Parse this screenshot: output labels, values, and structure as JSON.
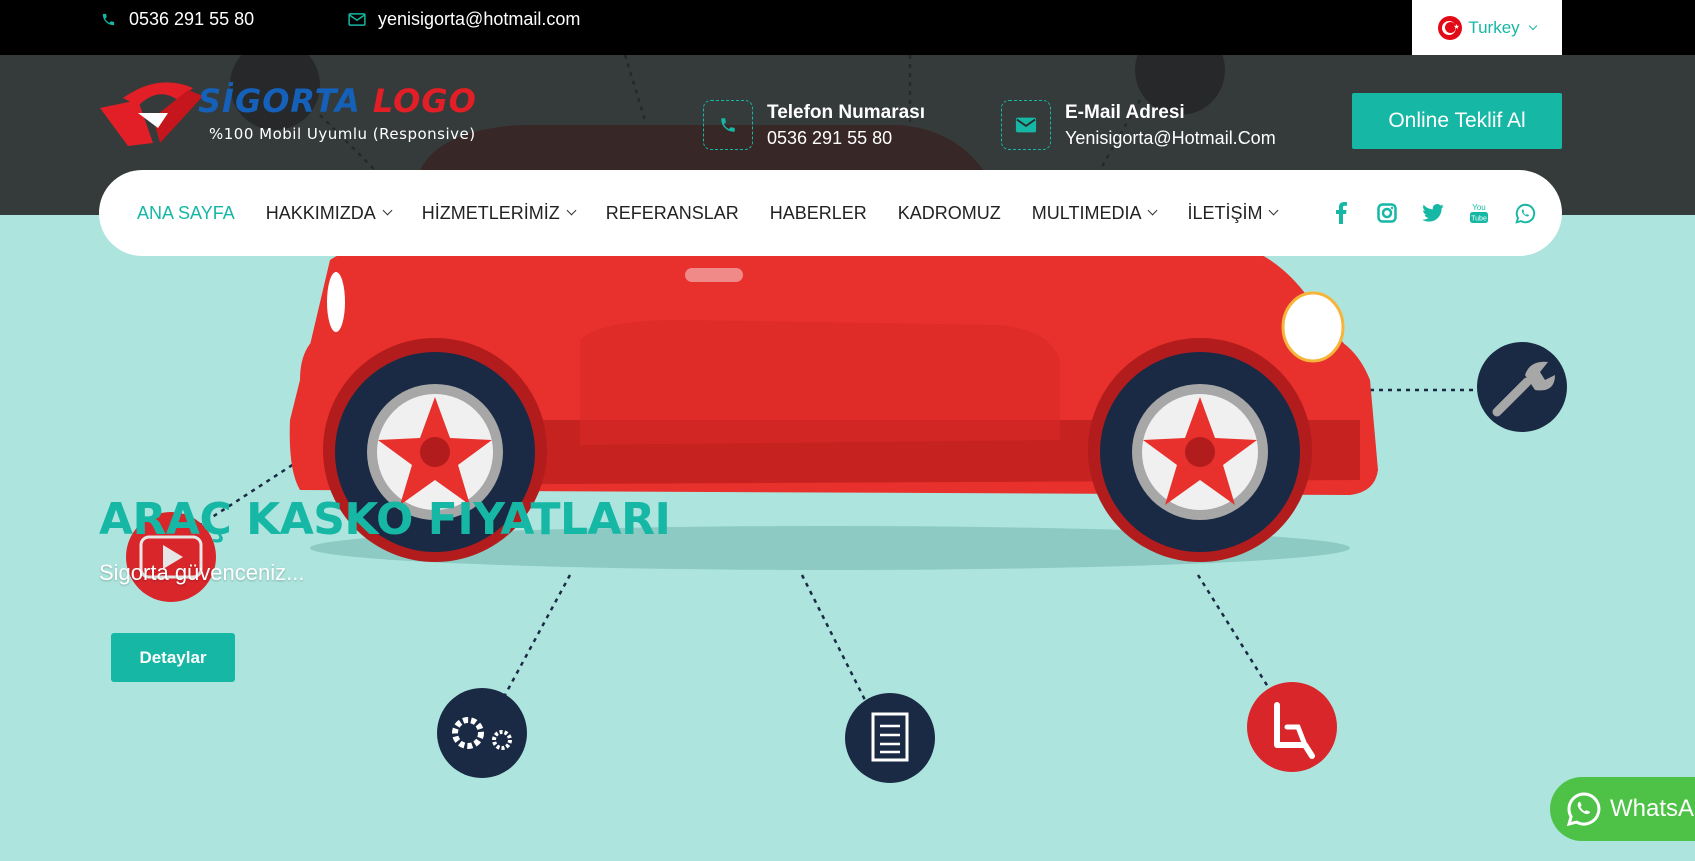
{
  "topbar": {
    "phone": "0536 291 55 80",
    "email": "yenisigorta@hotmail.com",
    "language": "Turkey"
  },
  "logo": {
    "word1": "SİGORTA",
    "word2": "LOGO",
    "tagline": "%100 Mobil Uyumlu (Responsive)"
  },
  "contacts": {
    "phone_title": "Telefon Numarası",
    "phone_value": "0536 291 55 80",
    "email_title": "E-Mail Adresi",
    "email_value": "Yenisigorta@Hotmail.Com"
  },
  "cta_label": "Online Teklif Al",
  "nav": {
    "items": [
      {
        "label": "ANA SAYFA",
        "active": true,
        "dropdown": false
      },
      {
        "label": "HAKKIMIZDA",
        "active": false,
        "dropdown": true
      },
      {
        "label": "HİZMETLERİMİZ",
        "active": false,
        "dropdown": true
      },
      {
        "label": "REFERANSLAR",
        "active": false,
        "dropdown": false
      },
      {
        "label": "HABERLER",
        "active": false,
        "dropdown": false
      },
      {
        "label": "KADROMUZ",
        "active": false,
        "dropdown": false
      },
      {
        "label": "MULTIMEDIA",
        "active": false,
        "dropdown": true
      },
      {
        "label": "İLETİŞİM",
        "active": false,
        "dropdown": true
      }
    ],
    "socials": [
      "facebook-icon",
      "instagram-icon",
      "twitter-icon",
      "youtube-icon",
      "whatsapp-icon"
    ]
  },
  "hero": {
    "title": "ARAÇ KASKO FIYATLARI",
    "subtitle": "Sigorta güvenceniz...",
    "button": "Detaylar"
  },
  "whatsapp_label": "WhatsA",
  "colors": {
    "accent": "#16b7a5",
    "hero_bg": "#ade5de",
    "car_red": "#e8302c",
    "dark_navy": "#1b2a44",
    "whatsapp_green": "#4dc247"
  }
}
